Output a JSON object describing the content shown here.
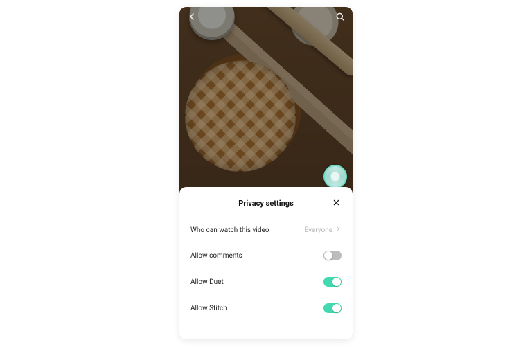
{
  "accent_on": "#43d9b0",
  "sheet": {
    "title": "Privacy settings",
    "rows": [
      {
        "label": "Who can watch this video",
        "kind": "select",
        "value": "Everyone"
      },
      {
        "label": "Allow comments",
        "kind": "toggle",
        "on": false
      },
      {
        "label": "Allow Duet",
        "kind": "toggle",
        "on": true
      },
      {
        "label": "Allow Stitch",
        "kind": "toggle",
        "on": true
      }
    ]
  }
}
